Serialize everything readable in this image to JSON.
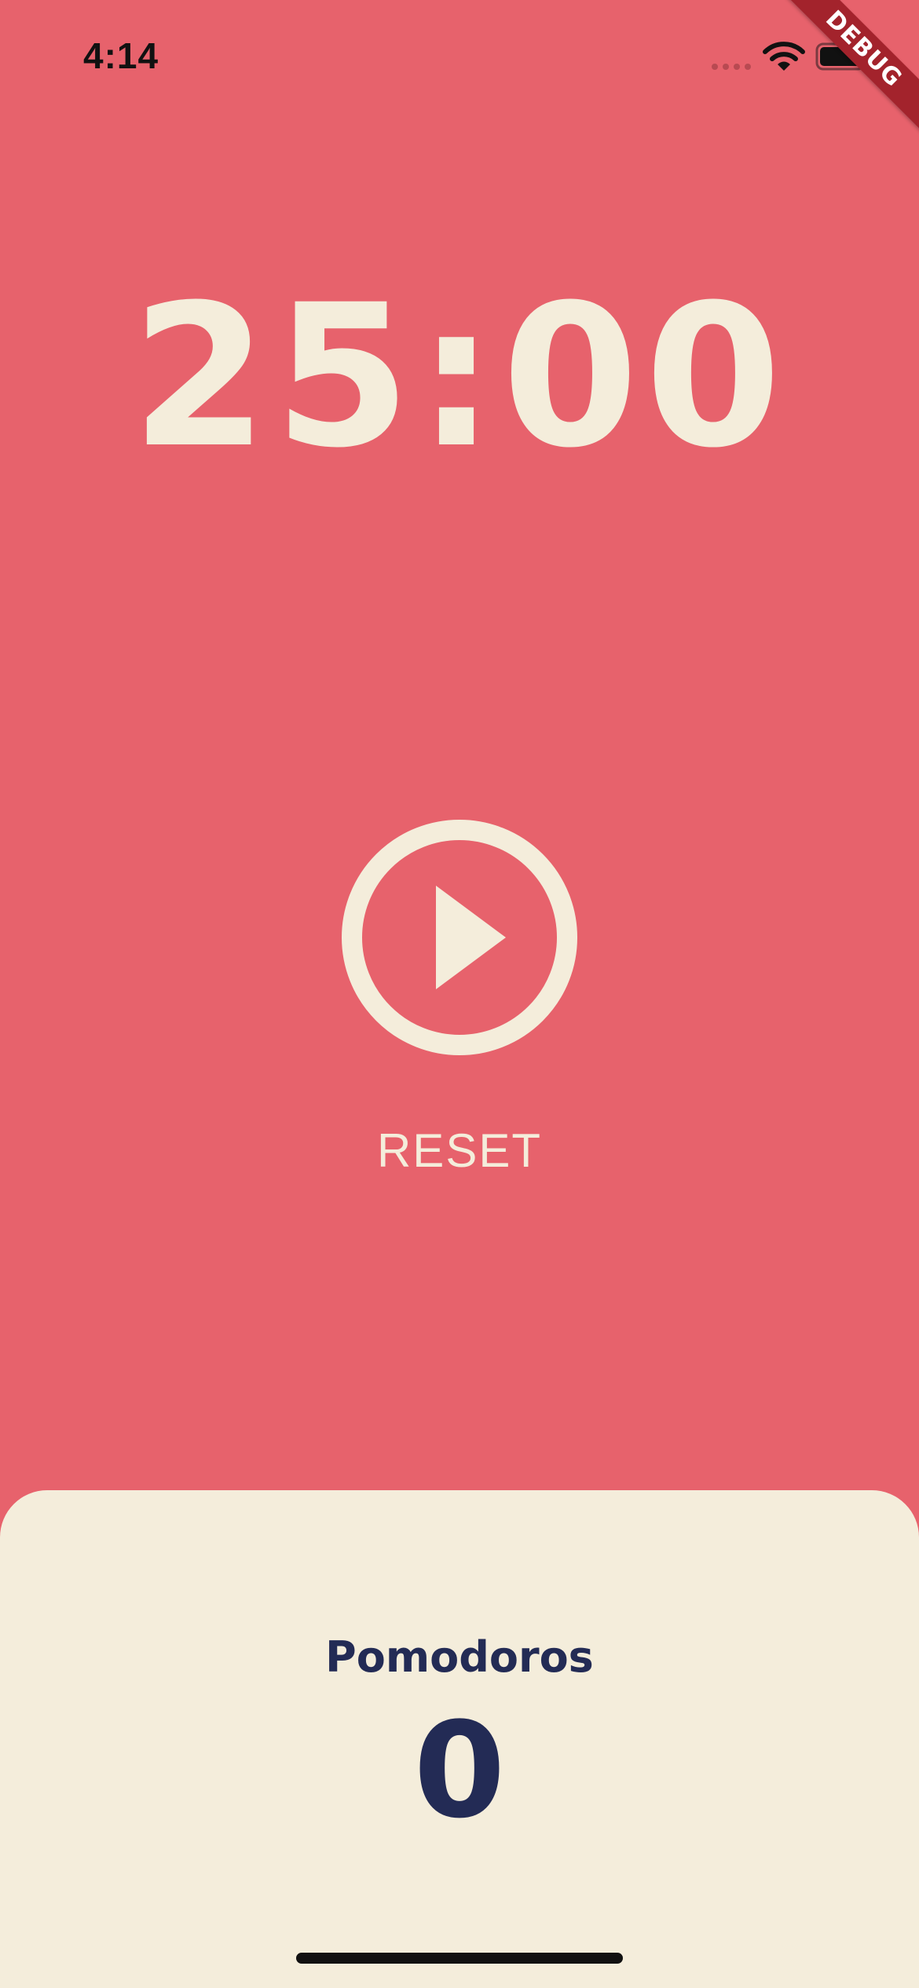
{
  "status_bar": {
    "time": "4:14"
  },
  "debug_banner": {
    "label": "DEBUG"
  },
  "timer": {
    "display": "25:00"
  },
  "controls": {
    "play_icon": "play-circle-icon",
    "reset_label": "RESET"
  },
  "pomodoros": {
    "label": "Pomodoros",
    "count": "0"
  },
  "colors": {
    "background": "#E7626C",
    "cream": "#F4EDDB",
    "navy": "#232B55",
    "debug_banner": "#A3232C"
  }
}
